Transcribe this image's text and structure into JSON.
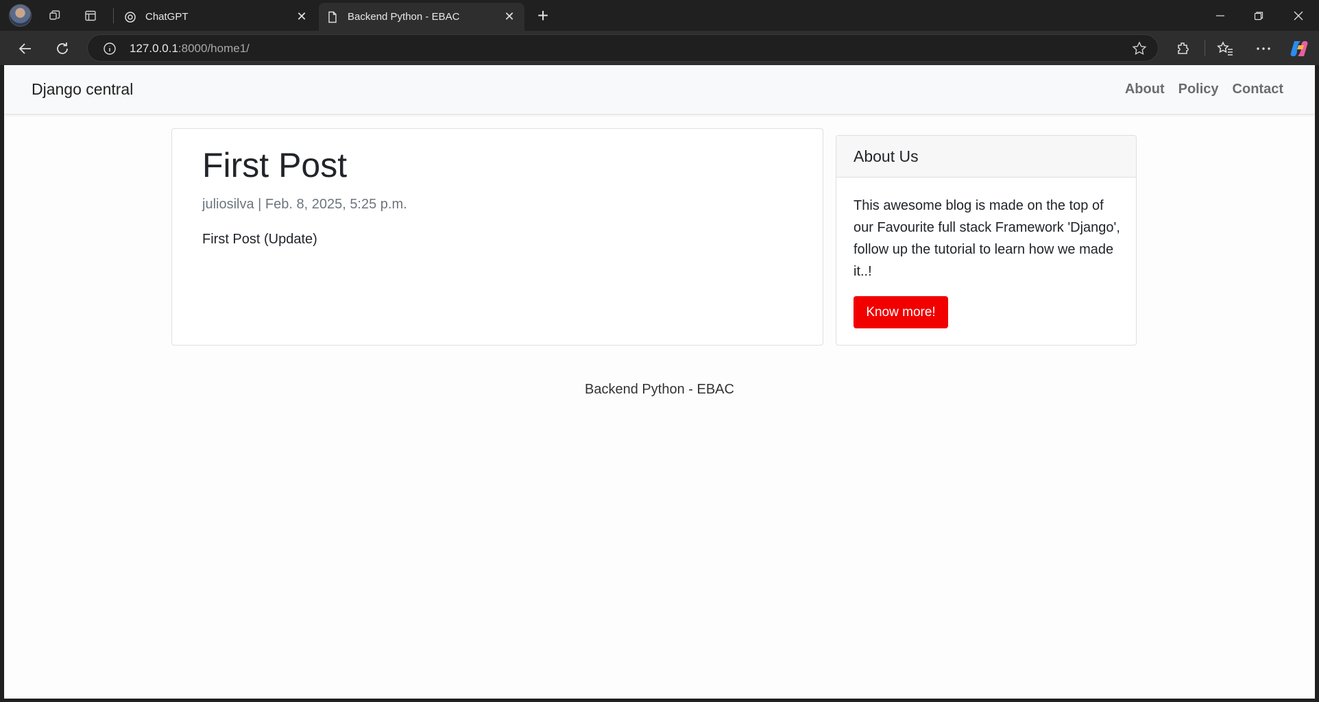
{
  "browser": {
    "tabs": [
      {
        "title": "ChatGPT",
        "favicon": "openai-icon",
        "active": false
      },
      {
        "title": "Backend Python - EBAC",
        "favicon": "page-icon",
        "active": true
      }
    ],
    "url_host": "127.0.0.1",
    "url_rest": ":8000/home1/"
  },
  "site": {
    "brand": "Django central",
    "nav_links": [
      "About",
      "Policy",
      "Contact"
    ]
  },
  "post": {
    "title": "First Post",
    "meta": "juliosilva | Feb. 8, 2025, 5:25 p.m.",
    "body": "First Post (Update)"
  },
  "sidebar": {
    "header": "About Us",
    "text": "This awesome blog is made on the top of our Favourite full stack Framework 'Django', follow up the tutorial to learn how we made it..!",
    "button": "Know more!",
    "button_color": "#f20000"
  },
  "footer": {
    "text": "Backend Python - EBAC"
  }
}
